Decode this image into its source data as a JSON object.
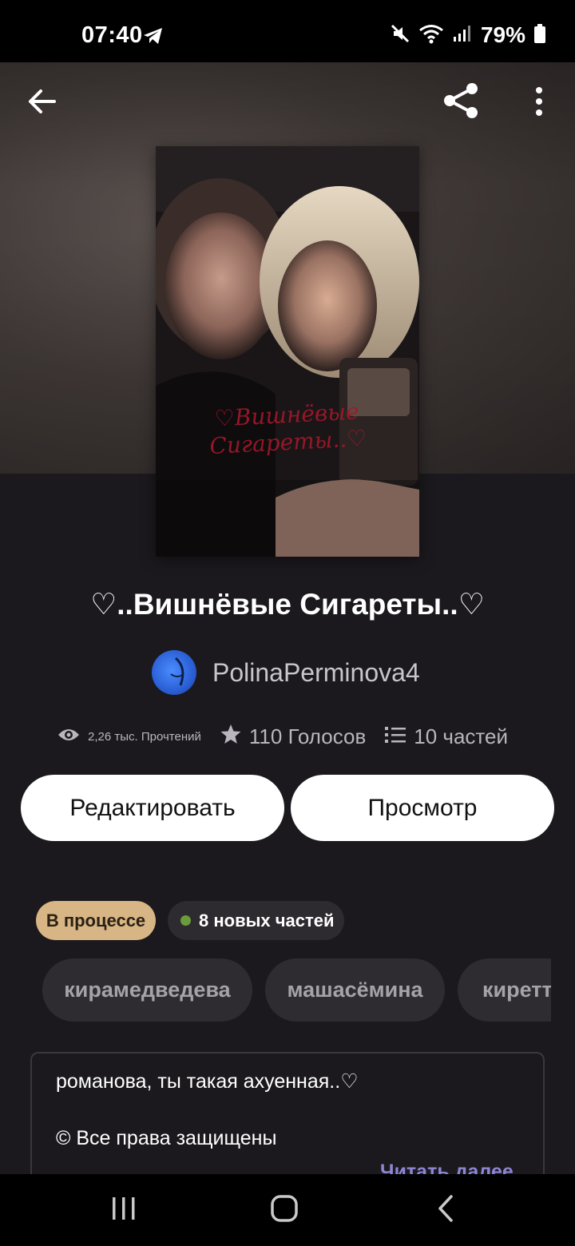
{
  "status_bar": {
    "time": "07:40",
    "battery": "79%",
    "icons": [
      "telegram-icon",
      "mute-icon",
      "wifi-icon",
      "signal-icon",
      "battery-icon"
    ]
  },
  "topbar": {
    "icons": [
      "back-arrow-icon",
      "share-icon",
      "more-vertical-icon"
    ]
  },
  "cover": {
    "title_text": "♡Вишнёвые Сигареты..♡"
  },
  "story": {
    "title": "♡..Вишнёвые Сигареты..♡",
    "author": "PolinaPerminova4",
    "stats": {
      "reads": "2,26 тыс. Прочтений",
      "votes": "110 Голосов",
      "parts": "10 частей"
    }
  },
  "actions": {
    "edit_label": "Редактировать",
    "view_label": "Просмотр"
  },
  "badges": {
    "status": "В процессе",
    "new_parts": "8 новых частей"
  },
  "tags": [
    "кирамедведева",
    "машасёмина",
    "киретт"
  ],
  "description": {
    "line1": "романова, ты такая ахуенная..♡",
    "line2": "© Все права защищены",
    "read_more": "Читать далее"
  },
  "colors": {
    "background": "#1b191d",
    "badge_progress": "#d7b584",
    "new_dot": "#6b9c3b",
    "read_more": "#8b86d4"
  }
}
